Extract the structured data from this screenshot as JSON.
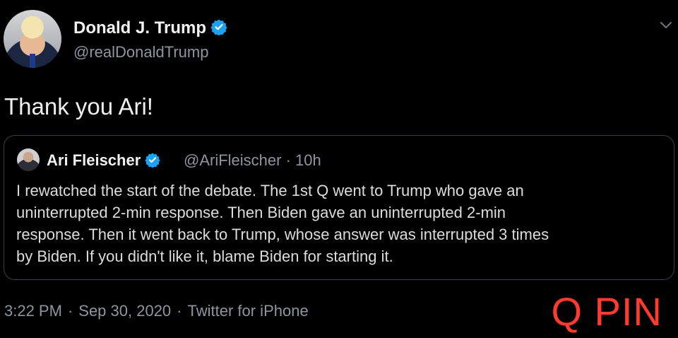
{
  "colors": {
    "background": "#000000",
    "verified_badge": "#1da1f2",
    "watermark": "#ff3b30"
  },
  "author": {
    "name": "Donald J. Trump",
    "handle": "@realDonaldTrump",
    "verified": true
  },
  "tweet": {
    "text": "Thank you Ari!"
  },
  "quoted_tweet": {
    "name": "Ari Fleischer",
    "handle_time": "@AriFleischer · 10h",
    "verified": true,
    "lines": [
      "I rewatched the start of the debate. The 1st Q went to Trump who gave an",
      "uninterrupted 2-min response. Then Biden gave an uninterrupted 2-min",
      "response. Then it went back to Trump, whose answer was interrupted 3 times",
      "by Biden. If you didn't like it, blame Biden for starting it."
    ]
  },
  "meta": {
    "time": "3:22 PM",
    "date": "Sep 30, 2020",
    "source": "Twitter for iPhone",
    "separator": "·"
  },
  "watermark": "Q PIN",
  "icons": {
    "verified": "verified-badge-icon",
    "menu": "chevron-down-icon"
  }
}
